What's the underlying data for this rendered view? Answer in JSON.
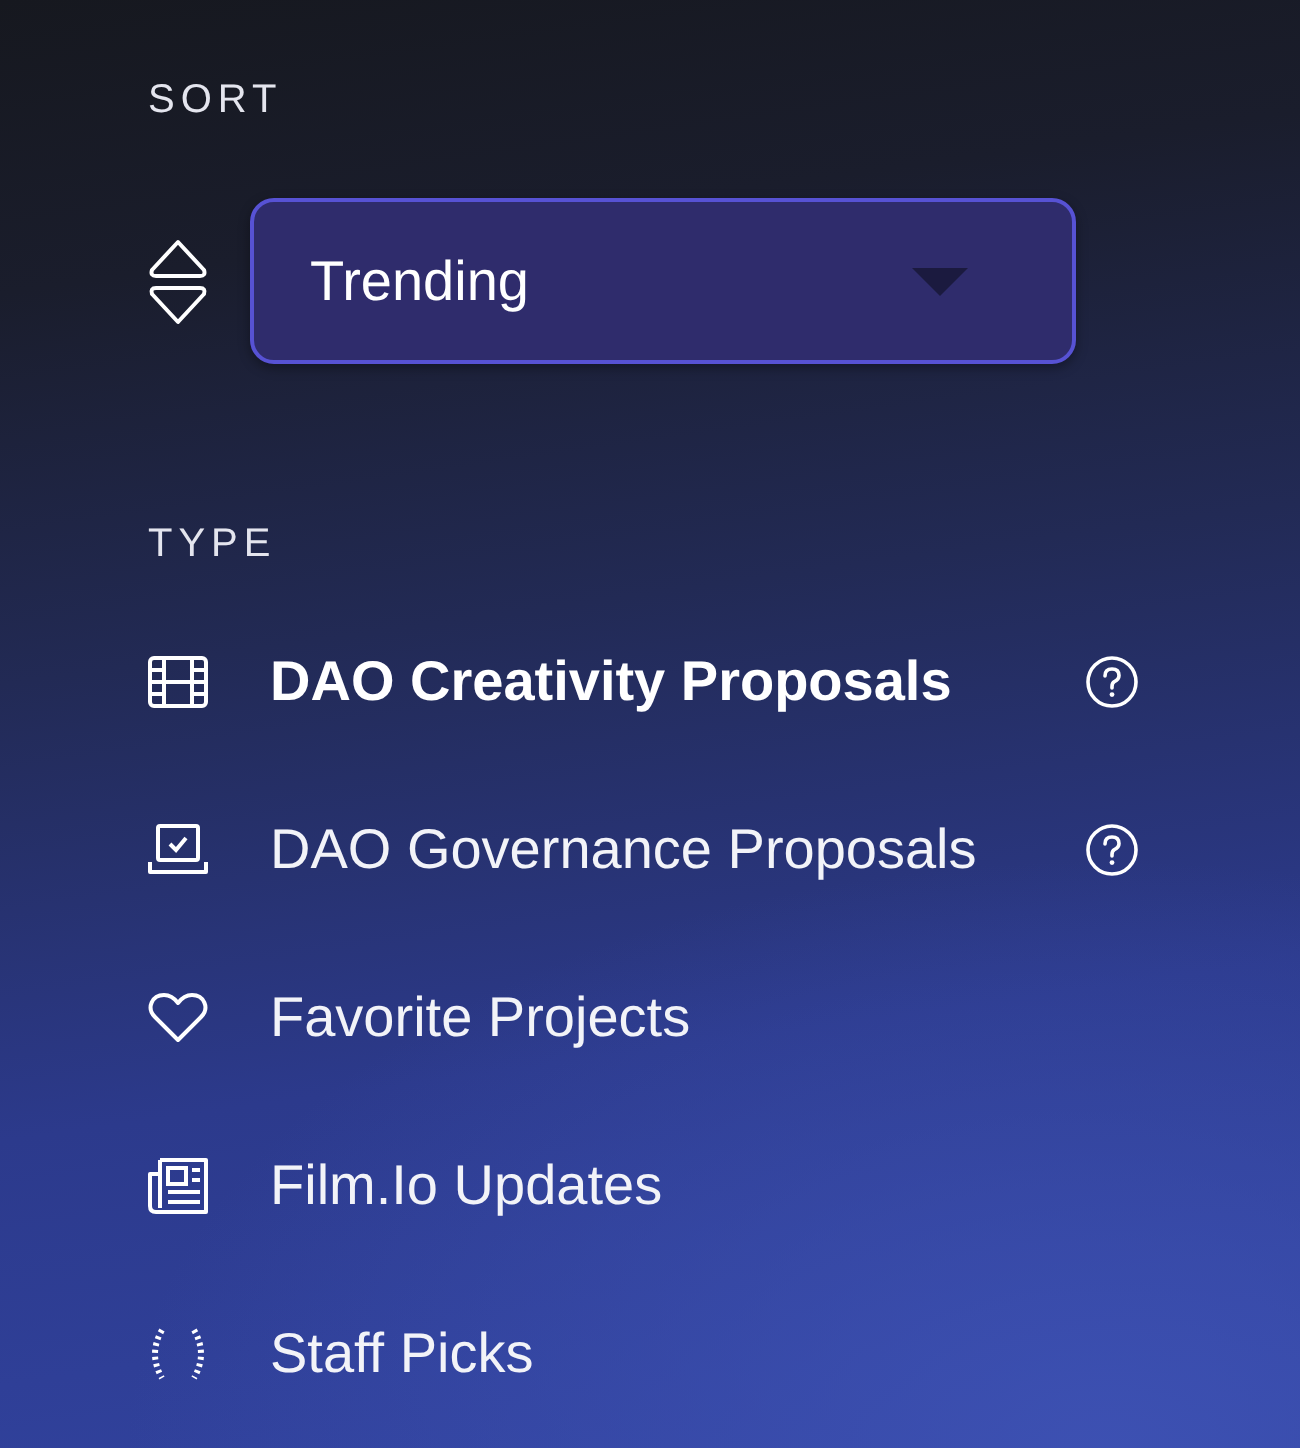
{
  "sort": {
    "label": "SORT",
    "dropdown": {
      "value": "Trending"
    }
  },
  "type": {
    "label": "TYPE",
    "items": [
      {
        "label": "DAO Creativity Proposals",
        "selected": true,
        "help": true
      },
      {
        "label": "DAO Governance Proposals",
        "selected": false,
        "help": true
      },
      {
        "label": "Favorite Projects",
        "selected": false,
        "help": false
      },
      {
        "label": "Film.Io Updates",
        "selected": false,
        "help": false
      },
      {
        "label": "Staff Picks",
        "selected": false,
        "help": false
      }
    ]
  }
}
